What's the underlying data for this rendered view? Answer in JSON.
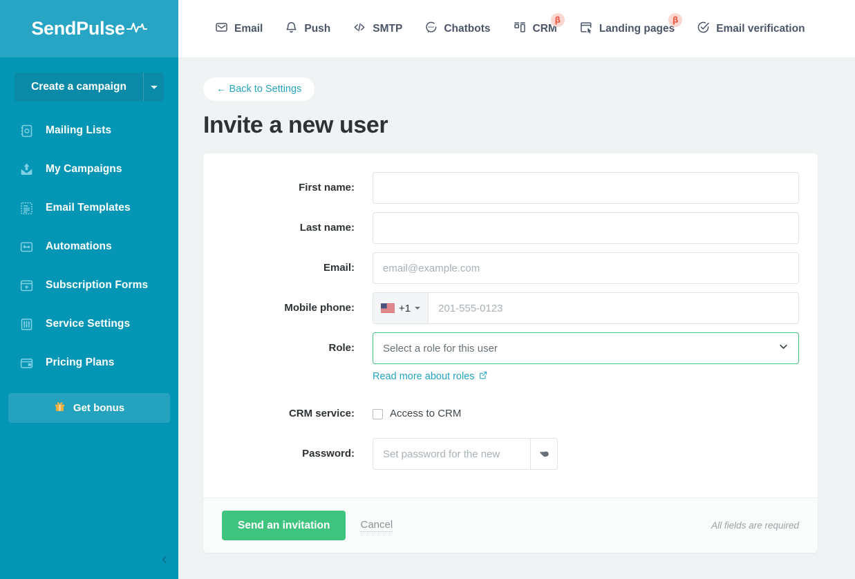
{
  "colors": {
    "sidebar_bg": "#0595b5",
    "sidebar_header_bg": "#28a5c4",
    "accent_teal": "#23a4c0",
    "accent_green": "#3fc47f",
    "beta_badge_bg": "#fbd7d2",
    "beta_badge_text": "#ef5b49",
    "page_bg": "#eff3f4"
  },
  "sidebar": {
    "logo_text": "SendPulse",
    "logo_icon": "pulse-wave-icon",
    "create_campaign": {
      "label": "Create a campaign",
      "caret_icon": "caret-down-icon"
    },
    "items": [
      {
        "label": "Mailing Lists",
        "icon": "address-book-icon"
      },
      {
        "label": "My Campaigns",
        "icon": "upload-campaign-icon"
      },
      {
        "label": "Email Templates",
        "icon": "template-icon"
      },
      {
        "label": "Automations",
        "icon": "automation-flow-icon"
      },
      {
        "label": "Subscription Forms",
        "icon": "form-icon"
      },
      {
        "label": "Service Settings",
        "icon": "sliders-icon"
      },
      {
        "label": "Pricing Plans",
        "icon": "wallet-icon"
      }
    ],
    "get_bonus": {
      "label": "Get bonus",
      "icon": "gift-icon"
    },
    "collapse_icon": "chevron-left-icon"
  },
  "topnav": {
    "items": [
      {
        "label": "Email",
        "icon": "envelope-icon",
        "badge": ""
      },
      {
        "label": "Push",
        "icon": "bell-icon",
        "badge": ""
      },
      {
        "label": "SMTP",
        "icon": "code-icon",
        "badge": ""
      },
      {
        "label": "Chatbots",
        "icon": "chat-bubble-icon",
        "badge": ""
      },
      {
        "label": "CRM",
        "icon": "crm-board-icon",
        "badge": "β"
      },
      {
        "label": "Landing pages",
        "icon": "landing-page-icon",
        "badge": "β"
      },
      {
        "label": "Email verification",
        "icon": "check-circle-icon",
        "badge": ""
      }
    ]
  },
  "page": {
    "back_label": "← Back to Settings",
    "title": "Invite a new user"
  },
  "form": {
    "first_name": {
      "label": "First name:",
      "value": "",
      "placeholder": ""
    },
    "last_name": {
      "label": "Last name:",
      "value": "",
      "placeholder": ""
    },
    "email": {
      "label": "Email:",
      "value": "",
      "placeholder": "email@example.com"
    },
    "mobile_phone": {
      "label": "Mobile phone:",
      "country_flag": "us-flag-icon",
      "country_code": "+1",
      "value": "",
      "placeholder": "201-555-0123"
    },
    "role": {
      "label": "Role:",
      "selected": "Select a role for this user",
      "chevron_icon": "chevron-down-icon",
      "read_more_label": "Read more about roles",
      "read_more_icon": "external-link-icon"
    },
    "crm_service": {
      "label": "CRM service:",
      "checkbox_label": "Access to CRM",
      "checked": false
    },
    "password": {
      "label": "Password:",
      "value": "",
      "placeholder": "Set password for the new",
      "generate_icon": "key-icon"
    }
  },
  "footer": {
    "submit_label": "Send an invitation",
    "cancel_label": "Cancel",
    "required_note": "All fields are required"
  }
}
